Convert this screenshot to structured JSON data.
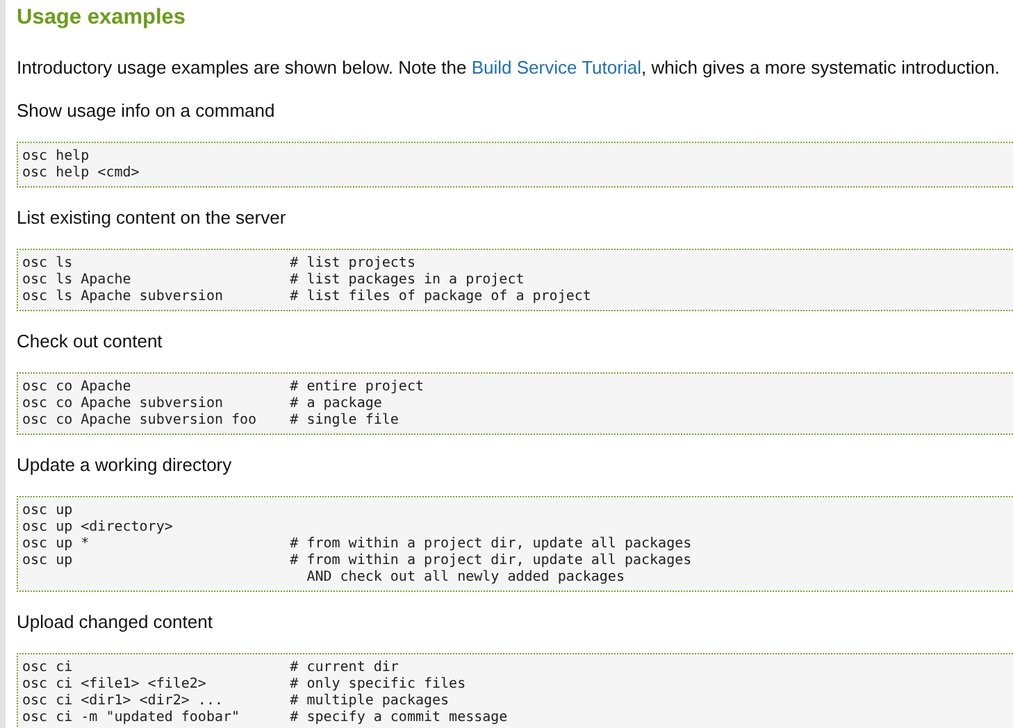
{
  "heading": "Usage examples",
  "intro": {
    "before": "Introductory usage examples are shown below. Note the ",
    "link": "Build Service Tutorial",
    "after": ", which gives a more systematic introduction."
  },
  "sections": [
    {
      "title": "Show usage info on a command",
      "lines": [
        "osc help",
        "osc help <cmd>"
      ]
    },
    {
      "title": "List existing content on the server",
      "lines": [
        "osc ls                          # list projects",
        "osc ls Apache                   # list packages in a project",
        "osc ls Apache subversion        # list files of package of a project"
      ]
    },
    {
      "title": "Check out content",
      "lines": [
        "osc co Apache                   # entire project",
        "osc co Apache subversion        # a package",
        "osc co Apache subversion foo    # single file"
      ]
    },
    {
      "title": "Update a working directory",
      "lines": [
        "osc up",
        "osc up <directory>",
        "osc up *                        # from within a project dir, update all packages",
        "osc up                          # from within a project dir, update all packages",
        "                                  AND check out all newly added packages"
      ]
    },
    {
      "title": "Upload changed content",
      "lines": [
        "osc ci                          # current dir",
        "osc ci <file1> <file2>          # only specific files",
        "osc ci <dir1> <dir2> ...        # multiple packages",
        "osc ci -m \"updated foobar\"      # specify a commit message"
      ]
    }
  ]
}
